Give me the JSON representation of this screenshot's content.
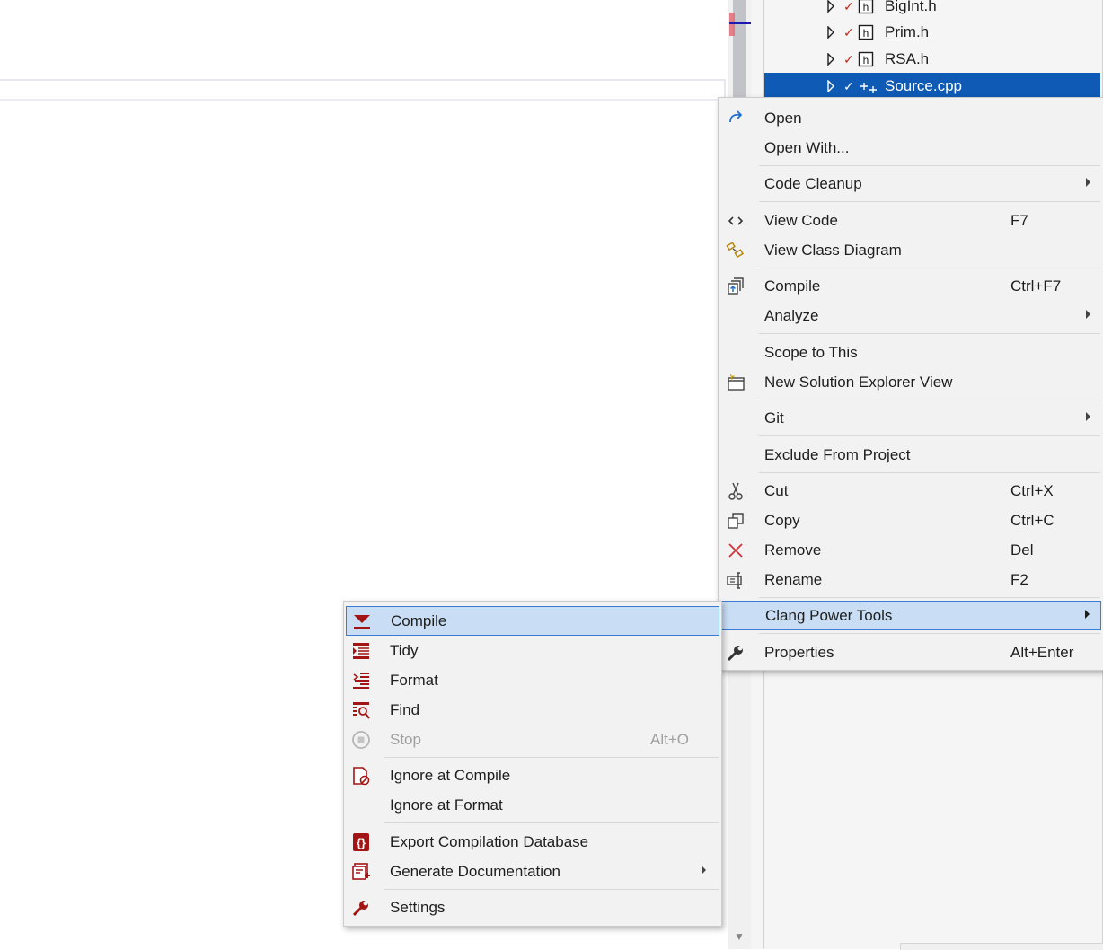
{
  "explorer": {
    "files": [
      {
        "label": "BigInt.h",
        "status": "checked",
        "type": "header"
      },
      {
        "label": "Prim.h",
        "status": "checked",
        "type": "header"
      },
      {
        "label": "RSA.h",
        "status": "checked",
        "type": "header"
      },
      {
        "label": "Source.cpp",
        "status": "added",
        "type": "cpp",
        "selected": true
      }
    ]
  },
  "context_menu": {
    "items": [
      {
        "label": "Open",
        "icon": "open-arrow-icon"
      },
      {
        "label": "Open With..."
      },
      {
        "label": "Code Cleanup",
        "submenu": true
      },
      {
        "label": "View Code",
        "shortcut": "F7",
        "icon": "code-brackets-icon"
      },
      {
        "label": "View Class Diagram",
        "icon": "class-diagram-icon"
      },
      {
        "label": "Compile",
        "shortcut": "Ctrl+F7",
        "icon": "compile-icon"
      },
      {
        "label": "Analyze",
        "submenu": true
      },
      {
        "label": "Scope to This"
      },
      {
        "label": "New Solution Explorer View",
        "icon": "new-window-icon"
      },
      {
        "label": "Git",
        "submenu": true
      },
      {
        "label": "Exclude From Project"
      },
      {
        "label": "Cut",
        "shortcut": "Ctrl+X",
        "icon": "scissors-icon"
      },
      {
        "label": "Copy",
        "shortcut": "Ctrl+C",
        "icon": "copy-icon"
      },
      {
        "label": "Remove",
        "shortcut": "Del",
        "icon": "red-x-icon"
      },
      {
        "label": "Rename",
        "shortcut": "F2",
        "icon": "rename-icon"
      },
      {
        "label": "Clang Power Tools",
        "submenu": true,
        "highlighted": true
      },
      {
        "label": "Properties",
        "shortcut": "Alt+Enter",
        "icon": "wrench-icon"
      }
    ]
  },
  "clang_submenu": {
    "items": [
      {
        "label": "Compile",
        "icon": "clang-compile-icon",
        "highlighted": true
      },
      {
        "label": "Tidy",
        "icon": "clang-tidy-icon"
      },
      {
        "label": "Format",
        "icon": "clang-format-icon"
      },
      {
        "label": "Find",
        "icon": "clang-find-icon"
      },
      {
        "label": "Stop",
        "shortcut": "Alt+O",
        "icon": "stop-icon",
        "disabled": true
      },
      {
        "label": "Ignore at Compile",
        "icon": "ignore-compile-icon"
      },
      {
        "label": "Ignore at Format"
      },
      {
        "label": "Export Compilation Database",
        "icon": "export-db-icon"
      },
      {
        "label": "Generate Documentation",
        "icon": "generate-doc-icon",
        "submenu": true
      },
      {
        "label": "Settings",
        "icon": "settings-wrench-icon"
      }
    ]
  },
  "colors": {
    "selection": "#0e5ab5",
    "menu_highlight": "#c9def5",
    "clang_red": "#a31515"
  }
}
